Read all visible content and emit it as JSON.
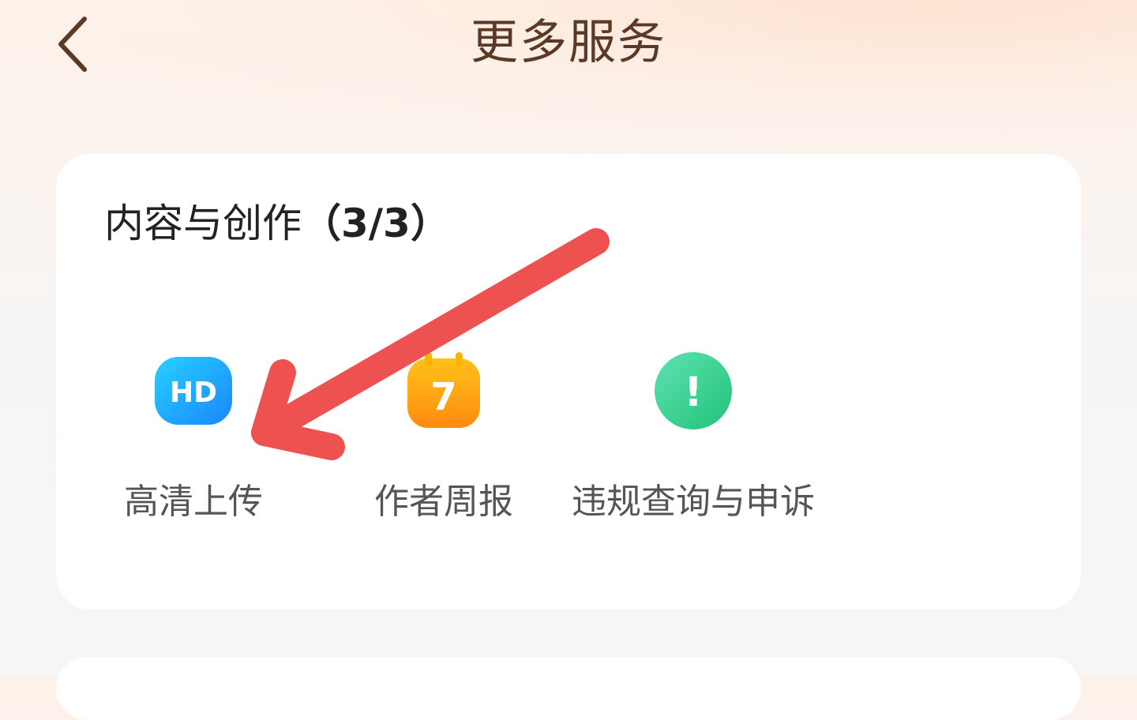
{
  "header": {
    "title": "更多服务",
    "back_icon": "chevron-left-icon"
  },
  "section": {
    "title": "内容与创作",
    "count": "（3/3）"
  },
  "services": [
    {
      "label": "高清上传",
      "icon": "hd-icon",
      "icon_text": "HD",
      "color": "#1e9bff"
    },
    {
      "label": "作者周报",
      "icon": "calendar-icon",
      "icon_text": "7",
      "color": "#ff9a10"
    },
    {
      "label": "违规查询与申诉",
      "icon": "exclamation-icon",
      "icon_text": "!",
      "color": "#33cc88"
    }
  ],
  "colors": {
    "title": "#5a3a25",
    "annotation_arrow": "#ee5250",
    "card": "#ffffff"
  }
}
